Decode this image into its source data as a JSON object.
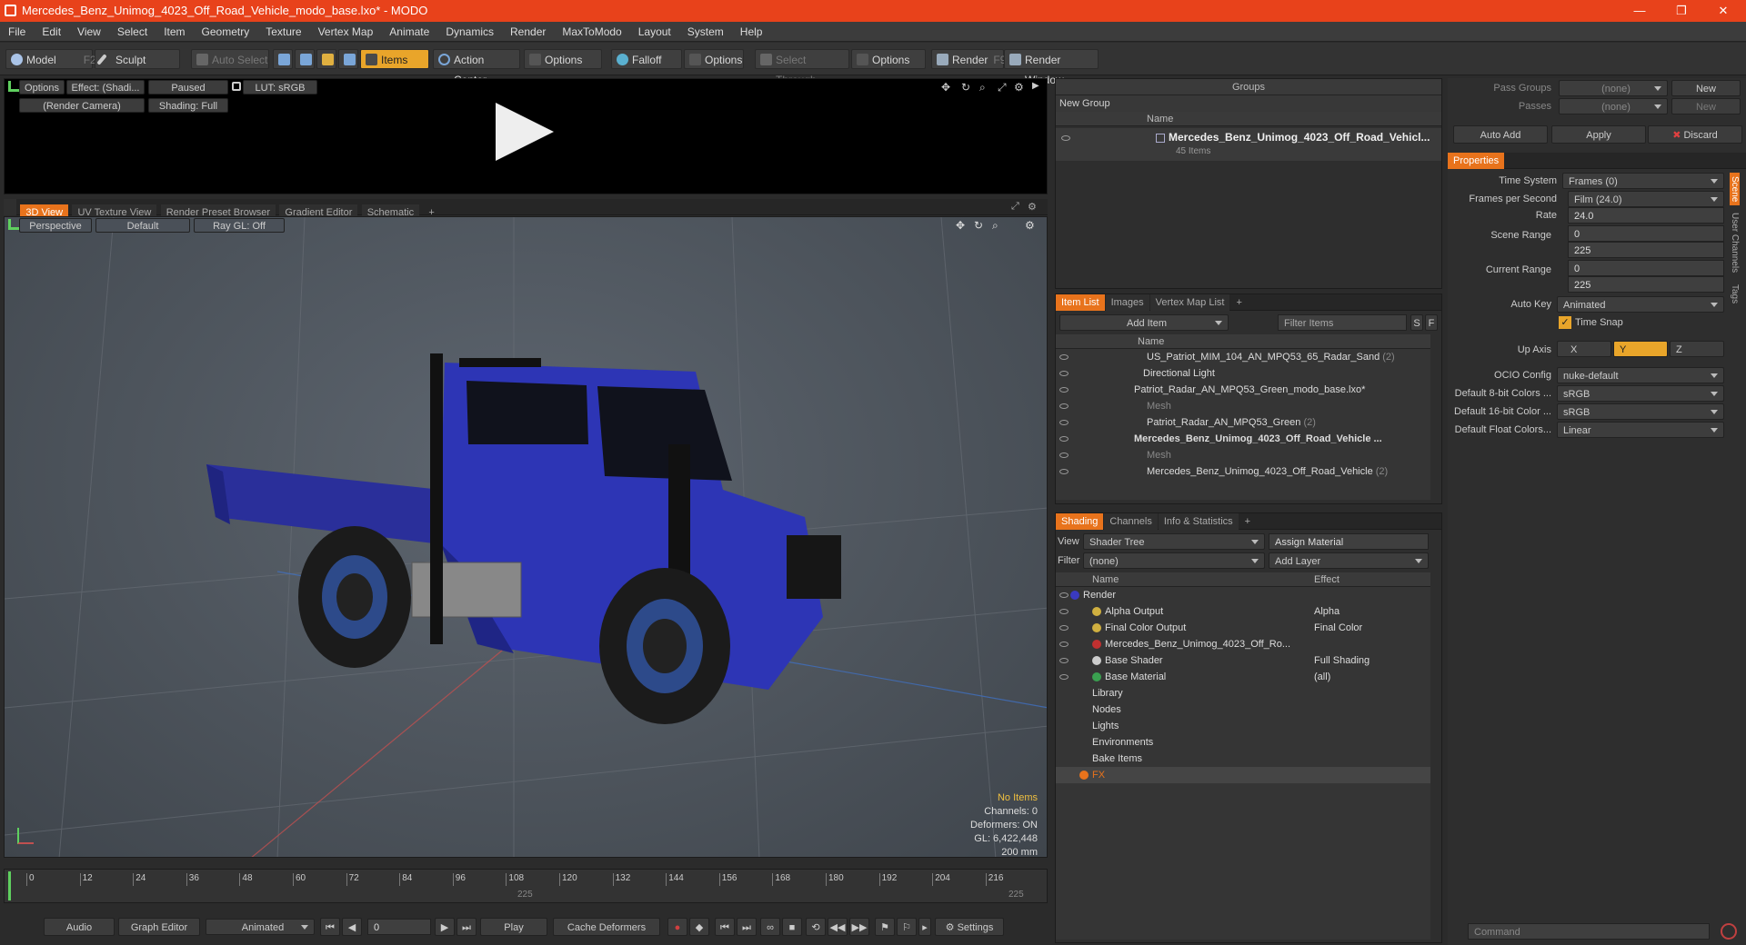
{
  "app": {
    "title": "Mercedes_Benz_Unimog_4023_Off_Road_Vehicle_modo_base.lxo* - MODO"
  },
  "menu": [
    "File",
    "Edit",
    "View",
    "Select",
    "Item",
    "Geometry",
    "Texture",
    "Vertex Map",
    "Animate",
    "Dynamics",
    "Render",
    "MaxToModo",
    "Layout",
    "System",
    "Help"
  ],
  "toolbar": {
    "model": "Model",
    "model_key": "F2",
    "sculpt": "Sculpt",
    "auto_select": "Auto Select",
    "items": "Items",
    "action_center": "Action Center",
    "options1": "Options",
    "falloff": "Falloff",
    "options2": "Options",
    "select_through": "Select Through",
    "options3": "Options",
    "render": "Render",
    "render_key": "F9",
    "render_window": "Render Window"
  },
  "preview": {
    "options": "Options",
    "effect": "Effect: (Shadi...",
    "paused": "Paused",
    "lut": "LUT: sRGB",
    "camera": "(Render Camera)",
    "shading": "Shading: Full"
  },
  "viewtabs": [
    "3D View",
    "UV Texture View",
    "Render Preset Browser",
    "Gradient Editor",
    "Schematic",
    "+"
  ],
  "viewport": {
    "perspective": "Perspective",
    "default": "Default",
    "raygl": "Ray GL: Off",
    "info": {
      "no_items": "No Items",
      "channels": "Channels: 0",
      "deformers": "Deformers: ON",
      "gl": "GL: 6,422,448",
      "size": "200 mm"
    }
  },
  "timeline": {
    "ticks": [
      "0",
      "12",
      "24",
      "36",
      "48",
      "60",
      "72",
      "84",
      "96",
      "108",
      "120",
      "132",
      "144",
      "156",
      "168",
      "180",
      "192",
      "204",
      "216"
    ],
    "mid": "225",
    "end": "225"
  },
  "bottombar": {
    "audio": "Audio",
    "graph_editor": "Graph Editor",
    "animated": "Animated",
    "frame": "0",
    "play": "Play",
    "cache": "Cache Deformers",
    "settings": "Settings"
  },
  "groups": {
    "title": "Groups",
    "new_group": "New Group",
    "name_col": "Name",
    "item_name": "Mercedes_Benz_Unimog_4023_Off_Road_Vehicl...",
    "item_count": "45 Items"
  },
  "itemlist": {
    "tabs": [
      "Item List",
      "Images",
      "Vertex Map List",
      "+"
    ],
    "add_item": "Add Item",
    "filter": "Filter Items",
    "s": "S",
    "f": "F",
    "name_col": "Name",
    "rows": [
      {
        "label": "US_Patriot_MIM_104_AN_MPQ53_65_Radar_Sand",
        "count": "(2)"
      },
      {
        "label": "Directional Light",
        "count": ""
      },
      {
        "label": "Patriot_Radar_AN_MPQ53_Green_modo_base.lxo*",
        "count": ""
      },
      {
        "label": "Mesh",
        "count": ""
      },
      {
        "label": "Patriot_Radar_AN_MPQ53_Green",
        "count": "(2)"
      },
      {
        "label": "Mercedes_Benz_Unimog_4023_Off_Road_Vehicle ...",
        "count": ""
      },
      {
        "label": "Mesh",
        "count": ""
      },
      {
        "label": "Mercedes_Benz_Unimog_4023_Off_Road_Vehicle",
        "count": "(2)"
      }
    ]
  },
  "shading": {
    "tabs": [
      "Shading",
      "Channels",
      "Info & Statistics",
      "+"
    ],
    "view_lbl": "View",
    "view_val": "Shader Tree",
    "assign": "Assign Material",
    "filter_lbl": "Filter",
    "filter_val": "(none)",
    "add_layer": "Add Layer",
    "name_col": "Name",
    "effect_col": "Effect",
    "rows": [
      {
        "label": "Render",
        "effect": ""
      },
      {
        "label": "Alpha Output",
        "effect": "Alpha"
      },
      {
        "label": "Final Color Output",
        "effect": "Final Color"
      },
      {
        "label": "Mercedes_Benz_Unimog_4023_Off_Ro...",
        "effect": ""
      },
      {
        "label": "Base Shader",
        "effect": "Full Shading"
      },
      {
        "label": "Base Material",
        "effect": "(all)"
      },
      {
        "label": "Library",
        "effect": ""
      },
      {
        "label": "Nodes",
        "effect": ""
      },
      {
        "label": "Lights",
        "effect": ""
      },
      {
        "label": "Environments",
        "effect": ""
      },
      {
        "label": "Bake Items",
        "effect": ""
      },
      {
        "label": "FX",
        "effect": ""
      }
    ]
  },
  "props": {
    "pass_groups": "Pass Groups",
    "passes": "Passes",
    "none": "(none)",
    "new": "New",
    "auto_add": "Auto Add",
    "apply": "Apply",
    "discard": "Discard",
    "tab": "Properties",
    "time_system": "Time System",
    "time_system_val": "Frames (0)",
    "fps": "Frames per Second",
    "fps_val": "Film (24.0)",
    "rate": "Rate",
    "rate_val": "24.0",
    "scene_range": "Scene Range",
    "sr1": "0",
    "sr2": "225",
    "current_range": "Current Range",
    "cr1": "0",
    "cr2": "225",
    "auto_key": "Auto Key",
    "auto_key_val": "Animated",
    "time_snap": "Time Snap",
    "up_axis": "Up Axis",
    "x": "X",
    "y": "Y",
    "z": "Z",
    "ocio": "OCIO Config",
    "ocio_val": "nuke-default",
    "d8": "Default 8-bit Colors ...",
    "d8v": "sRGB",
    "d16": "Default 16-bit Color ...",
    "d16v": "sRGB",
    "dfl": "Default Float Colors...",
    "dflv": "Linear",
    "side": [
      "Scene",
      "User Channels",
      "Tags"
    ],
    "command": "Command"
  }
}
